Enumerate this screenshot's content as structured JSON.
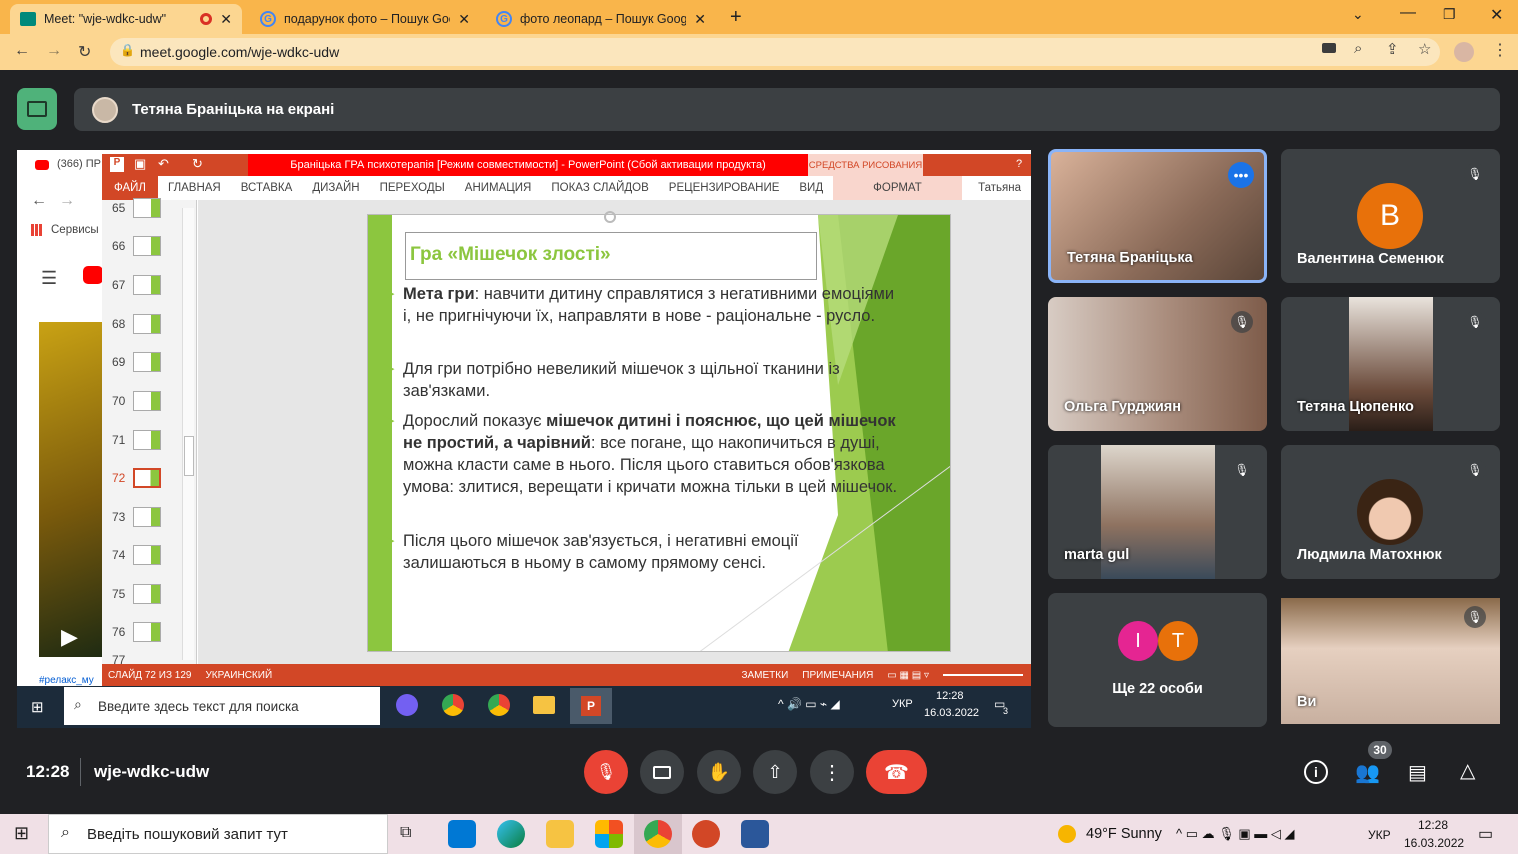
{
  "browser": {
    "tabs": [
      {
        "title": "Meet: \"wje-wdkc-udw\"",
        "active": true
      },
      {
        "title": "подарунок фото – Пошук Google",
        "active": false
      },
      {
        "title": "фото леопард – Пошук Google",
        "active": false
      }
    ],
    "url": "meet.google.com/wje-wdkc-udw"
  },
  "presenting": {
    "label": "Тетяна Браніцька на екрані"
  },
  "shared_screen": {
    "left_browser": {
      "tab_text": "(366) ПР",
      "bookmarks": "Сервисы",
      "hashtag": "#релакс_му"
    },
    "powerpoint": {
      "title": "Браніцька ГРА психотерапія [Режим совместимости] - PowerPoint (Сбой активации продукта)",
      "drawing_tools": "СРЕДСТВА РИСОВАНИЯ",
      "help": "?",
      "menu": [
        "ФАЙЛ",
        "ГЛАВНАЯ",
        "ВСТАВКА",
        "ДИЗАЙН",
        "ПЕРЕХОДЫ",
        "АНИМАЦИЯ",
        "ПОКАЗ СЛАЙДОВ",
        "РЕЦЕНЗИРОВАНИЕ",
        "ВИД",
        "ФОРМАТ"
      ],
      "user": "Татьяна",
      "thumbnails": [
        "65",
        "66",
        "67",
        "68",
        "69",
        "70",
        "71",
        "72",
        "73",
        "74",
        "75",
        "76",
        "77"
      ],
      "selected_slide": "72",
      "slide": {
        "title": "Гра «Мішечок злості»",
        "bullets": [
          {
            "bold_prefix": "Мета гри",
            "text": ": навчити дитину справлятися з негативними емоціями і, не пригнічуючи їх, направляти в нове - раціональне - русло."
          },
          {
            "bold_prefix": "",
            "text": "Для гри потрібно невеликий мішечок з щільної тканини із зав'язками."
          },
          {
            "bold_prefix": "",
            "text": "Дорослий показує ",
            "bold_mid": "мішечок дитині і пояснює, що цей мішечок не простий, а чарівний",
            "text_end": ": все погане, що накопичиться в душі, можна класти саме в нього. Після цього ставиться обов'язкова умова: злитися, верещати і кричати можна тільки в цей мішечок."
          },
          {
            "bold_prefix": "",
            "text": "Після цього мішечок зав'язується, і негативні емоції залишаються в ньому в самому прямому сенсі."
          }
        ]
      },
      "status": {
        "slide": "СЛАЙД 72 ИЗ 129",
        "language": "УКРАИНСКИЙ",
        "notes": "ЗАМЕТКИ",
        "comments": "ПРИМЕЧАНИЯ"
      }
    },
    "inner_taskbar": {
      "search_placeholder": "Введите здесь текст для поиска",
      "lang": "УКР",
      "time": "12:28",
      "date": "16.03.2022",
      "notif": "3"
    }
  },
  "participants": [
    {
      "name": "Тетяна Браніцька",
      "type": "video",
      "active": true
    },
    {
      "name": "Валентина Семенюк",
      "type": "avatar",
      "initial": "B",
      "color": "#e8710a",
      "muted": true
    },
    {
      "name": "Ольга Гурджиян",
      "type": "video",
      "muted": true
    },
    {
      "name": "Тетяна Цюпенко",
      "type": "video",
      "muted": true
    },
    {
      "name": "marta gul",
      "type": "video",
      "muted": true
    },
    {
      "name": "Людмила Матохнюк",
      "type": "photo",
      "muted": true
    },
    {
      "name": "Ще 22 особи",
      "type": "more",
      "initials": [
        "I",
        "T"
      ],
      "colors": [
        "#e52592",
        "#e8710a"
      ]
    },
    {
      "name": "Ви",
      "type": "video",
      "muted": true
    }
  ],
  "meeting": {
    "time": "12:28",
    "code": "wje-wdkc-udw",
    "people_count": "30"
  },
  "taskbar": {
    "search_placeholder": "Введіть пошуковий запит тут",
    "weather": "49°F  Sunny",
    "lang": "УКР",
    "time": "12:28",
    "date": "16.03.2022"
  },
  "colors": {
    "chrome_tab": "#f9b54b",
    "meet_bg": "#202124",
    "ppt_accent": "#d24726",
    "slide_green": "#8cc63f",
    "end_call": "#ea4335"
  }
}
